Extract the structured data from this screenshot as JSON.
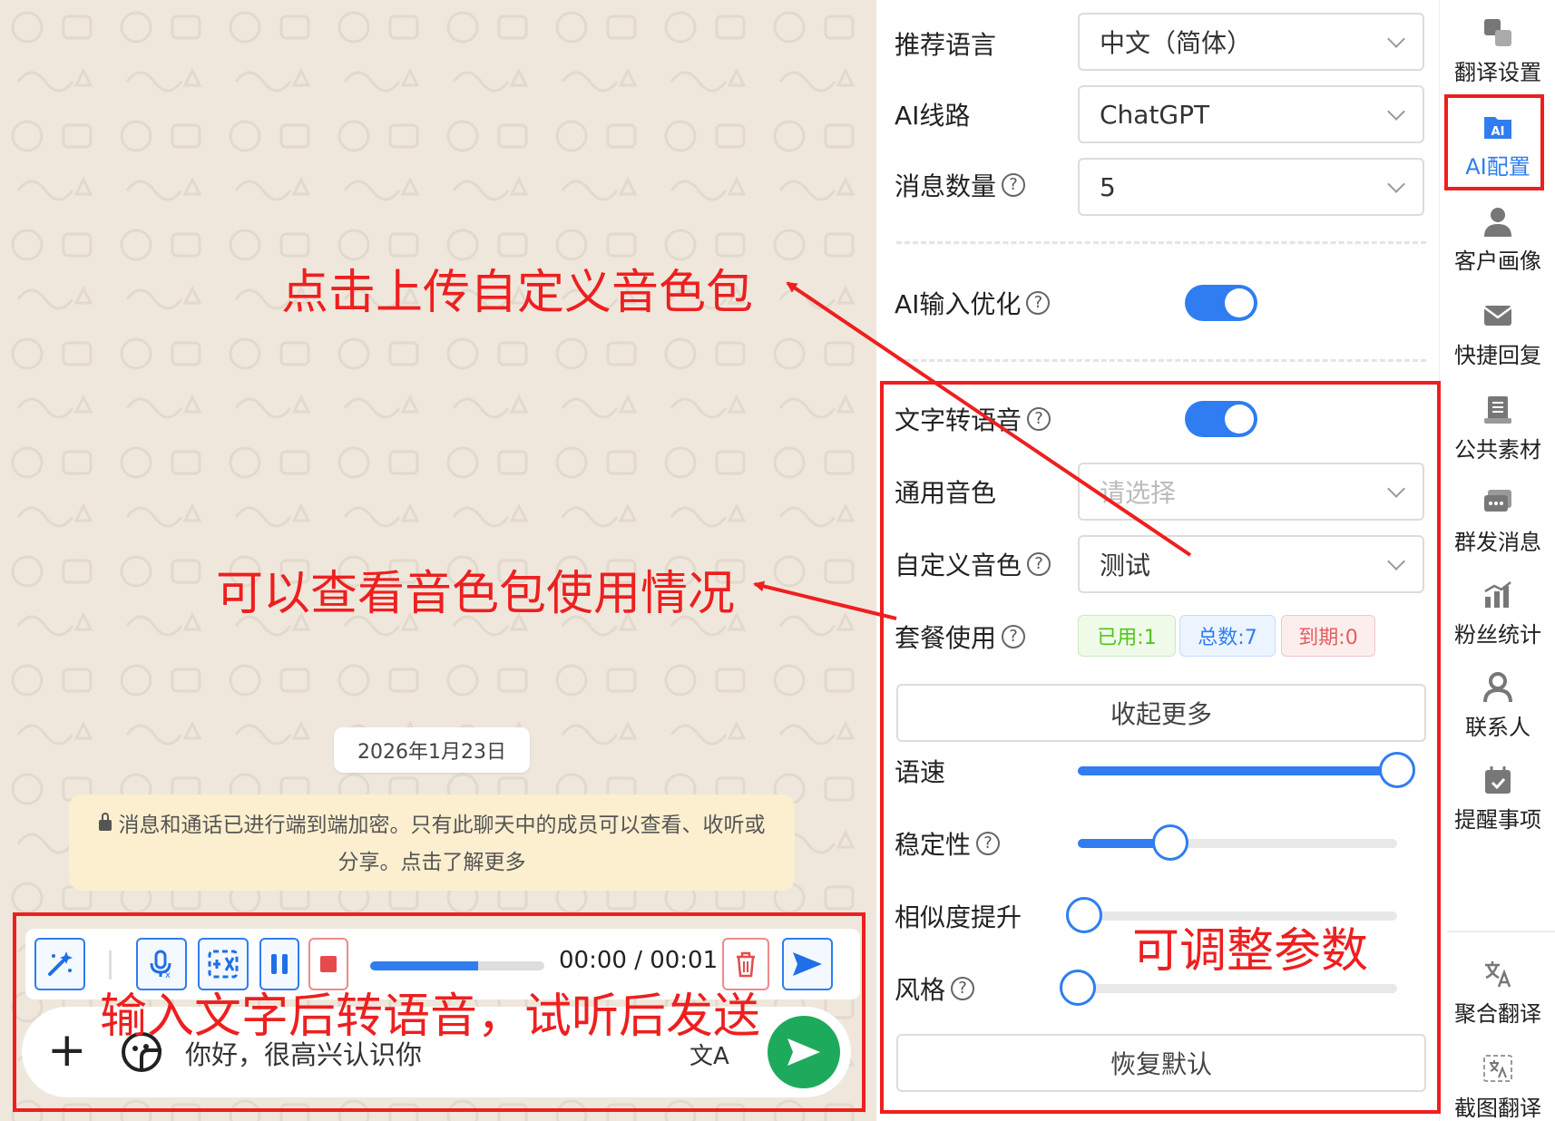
{
  "chat": {
    "date": "2026年1月23日",
    "encryption_notice": "消息和通话已进行端到端加密。只有此聊天中的成员可以查看、收听或分享。点击了解更多",
    "audio_progress": 0.62,
    "audio_time": "00:00 / 00:01",
    "message_input_value": "你好，很高兴认识你",
    "translate_glyph": "文A",
    "plus_glyph": "+"
  },
  "panel": {
    "rec_language_label": "推荐语言",
    "rec_language_value": "中文（简体）",
    "ai_line_label": "AI线路",
    "ai_line_value": "ChatGPT",
    "msg_count_label": "消息数量",
    "msg_count_value": "5",
    "ai_input_opt_label": "AI输入优化",
    "ai_input_opt_on": true,
    "tts_label": "文字转语音",
    "tts_on": true,
    "general_voice_label": "通用音色",
    "general_voice_placeholder": "请选择",
    "custom_voice_label": "自定义音色",
    "custom_voice_value": "测试",
    "plan_usage_label": "套餐使用",
    "tag_used": "已用:1",
    "tag_total": "总数:7",
    "tag_expired": "到期:0",
    "collapse_button": "收起更多",
    "speed_label": "语速",
    "speed_value": 1.0,
    "stability_label": "稳定性",
    "stability_value": 0.29,
    "similarity_label": "相似度提升",
    "similarity_value": 0.02,
    "style_label": "风格",
    "style_value": 0.0,
    "reset_button": "恢复默认",
    "help_glyph": "?"
  },
  "nav": {
    "items": [
      {
        "label": "翻译设置",
        "icon": "translate-settings-icon"
      },
      {
        "label": "AI配置",
        "icon": "ai-config-icon",
        "active": true
      },
      {
        "label": "客户画像",
        "icon": "customer-profile-icon"
      },
      {
        "label": "快捷回复",
        "icon": "quick-reply-icon"
      },
      {
        "label": "公共素材",
        "icon": "public-material-icon"
      },
      {
        "label": "群发消息",
        "icon": "broadcast-icon"
      },
      {
        "label": "粉丝统计",
        "icon": "fan-stats-icon"
      },
      {
        "label": "联系人",
        "icon": "contacts-icon"
      },
      {
        "label": "提醒事项",
        "icon": "reminder-icon"
      },
      {
        "label": "聚合翻译",
        "icon": "aggregate-translate-icon"
      },
      {
        "label": "截图翻译",
        "icon": "screenshot-translate-icon"
      }
    ],
    "ai_badge": "AI"
  },
  "annotations": {
    "upload_voice": "点击上传自定义音色包",
    "view_usage": "可以查看音色包使用情况",
    "adjust_params": "可调整参数",
    "tts_hint": "输入文字后转语音，试听后发送"
  },
  "colors": {
    "accent": "#2f7df0",
    "annotation_red": "#ee1f1f",
    "send_green": "#1eaa5c",
    "chat_bg": "#efe7dc"
  }
}
